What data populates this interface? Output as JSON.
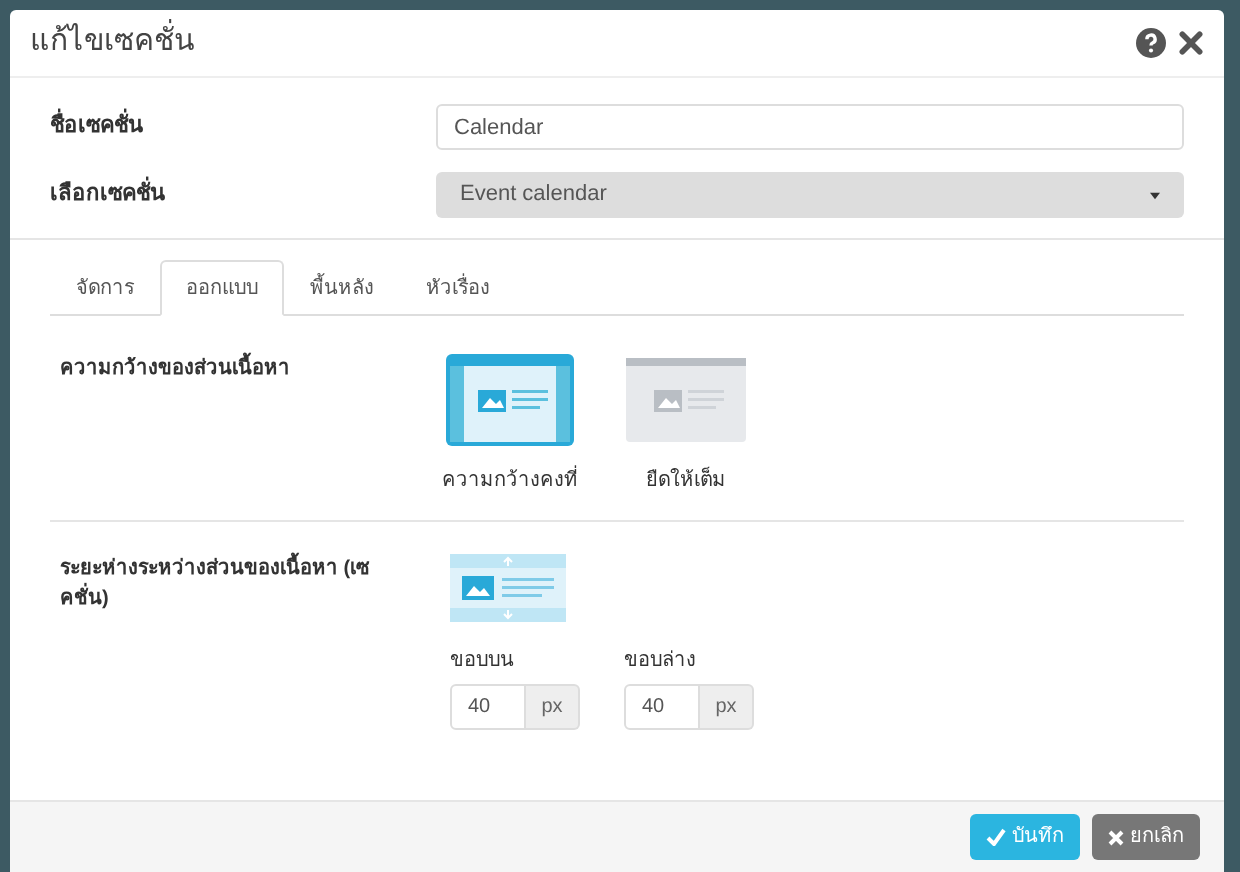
{
  "dialog": {
    "title": "แก้ไขเซคชั่น"
  },
  "fields": [
    {
      "kind": "text",
      "label": "ชื่อเซคชั่น",
      "value": "Calendar"
    },
    {
      "kind": "select",
      "label": "เลือกเซคชั่น",
      "value": "Event calendar"
    }
  ],
  "tabs": [
    {
      "label": "จัดการ",
      "selected": false
    },
    {
      "label": "ออกแบบ",
      "selected": true
    },
    {
      "label": "พื้นหลัง",
      "selected": false
    },
    {
      "label": "หัวเรื่อง",
      "selected": false
    }
  ],
  "content_width": {
    "label": "ความกว้างของส่วนเนื้อหา",
    "options": [
      {
        "label": "ความกว้างคงที่",
        "selected": true
      },
      {
        "label": "ยืดให้เต็ม",
        "selected": false
      }
    ]
  },
  "spacing": {
    "label": "ระยะห่างระหว่างส่วนของเนื้อหา (เซคชั่น)",
    "inputs": [
      {
        "label": "ขอบบน",
        "value": "40",
        "unit": "px"
      },
      {
        "label": "ขอบล่าง",
        "value": "40",
        "unit": "px"
      }
    ]
  },
  "buttons": [
    {
      "kind": "primary",
      "label": "บันทึก"
    },
    {
      "kind": "secondary",
      "label": "ยกเลิก"
    }
  ]
}
